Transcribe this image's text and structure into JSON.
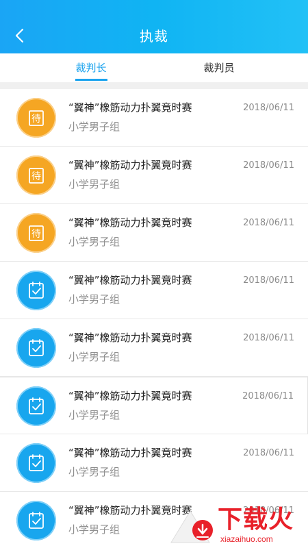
{
  "header": {
    "title": "执裁"
  },
  "tabs": [
    {
      "label": "裁判长",
      "active": true
    },
    {
      "label": "裁判员",
      "active": false
    }
  ],
  "list": {
    "items": [
      {
        "status": "pending",
        "icon": "pending-icon",
        "badge": "待",
        "title": "“翼神”橡筋动力扑翼竟时赛",
        "subtitle": "小学男子组",
        "date": "2018/06/11"
      },
      {
        "status": "pending",
        "icon": "pending-icon",
        "badge": "待",
        "title": "“翼神”橡筋动力扑翼竟时赛",
        "subtitle": "小学男子组",
        "date": "2018/06/11"
      },
      {
        "status": "pending",
        "icon": "pending-icon",
        "badge": "待",
        "title": "“翼神”橡筋动力扑翼竟时赛",
        "subtitle": "小学男子组",
        "date": "2018/06/11"
      },
      {
        "status": "done",
        "icon": "clipboard-check-icon",
        "title": "“翼神”橡筋动力扑翼竟时赛",
        "subtitle": "小学男子组",
        "date": "2018/06/11"
      },
      {
        "status": "done",
        "icon": "clipboard-check-icon",
        "title": "“翼神”橡筋动力扑翼竟时赛",
        "subtitle": "小学男子组",
        "date": "2018/06/11"
      },
      {
        "status": "done",
        "icon": "clipboard-check-icon",
        "title": "“翼神”橡筋动力扑翼竟时赛",
        "subtitle": "小学男子组",
        "date": "2018/06/11"
      },
      {
        "status": "done",
        "icon": "clipboard-check-icon",
        "title": "“翼神”橡筋动力扑翼竟时赛",
        "subtitle": "小学男子组",
        "date": "2018/06/11"
      },
      {
        "status": "done",
        "icon": "clipboard-check-icon",
        "title": "“翼神”橡筋动力扑翼竟时赛",
        "subtitle": "小学男子组",
        "date": "2018/06/11"
      }
    ]
  },
  "watermark": {
    "text": "下载火",
    "site": "xiazaihuo.com"
  },
  "colors": {
    "header": "#10b4f3",
    "accent": "#1aa3ee",
    "pending": "#f5a623",
    "done": "#18a6ee"
  }
}
